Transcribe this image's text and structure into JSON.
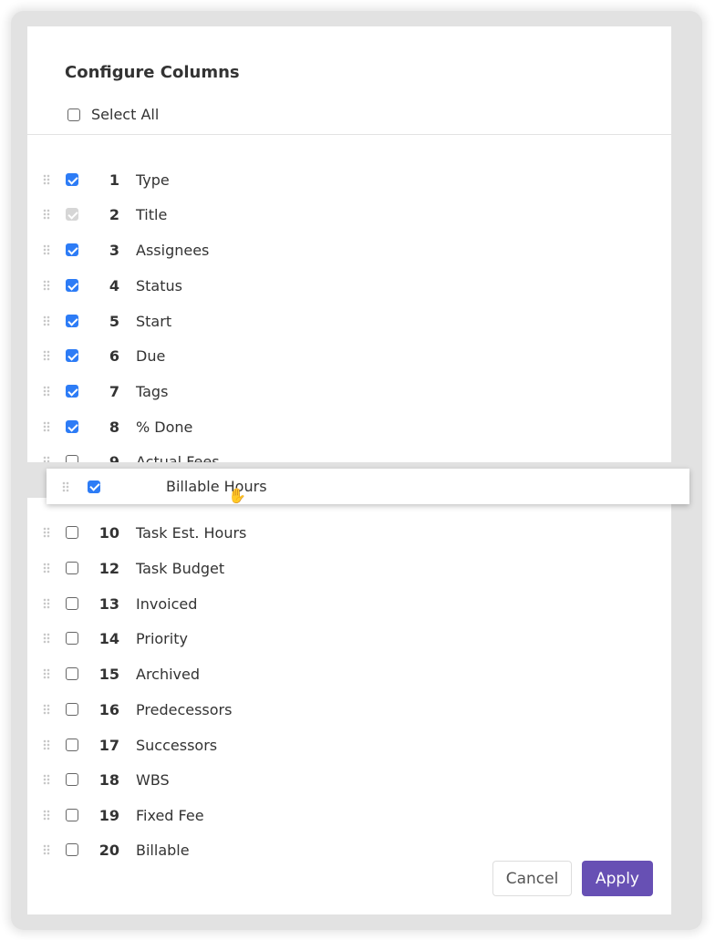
{
  "dialog": {
    "title": "Configure Columns",
    "select_all_label": "Select All",
    "select_all_checked": false,
    "cancel_label": "Cancel",
    "apply_label": "Apply",
    "accent_color": "#6750b4",
    "checkbox_color": "#2d7cf6"
  },
  "columns_top": [
    {
      "num": "1",
      "label": "Type",
      "state": "checked"
    },
    {
      "num": "2",
      "label": "Title",
      "state": "disabled-checked"
    },
    {
      "num": "3",
      "label": "Assignees",
      "state": "checked"
    },
    {
      "num": "4",
      "label": "Status",
      "state": "checked"
    },
    {
      "num": "5",
      "label": "Start",
      "state": "checked"
    },
    {
      "num": "6",
      "label": "Due",
      "state": "checked"
    },
    {
      "num": "7",
      "label": "Tags",
      "state": "checked"
    },
    {
      "num": "8",
      "label": "% Done",
      "state": "checked"
    },
    {
      "num": "9",
      "label": "Actual Fees",
      "state": "unchecked"
    }
  ],
  "dragging": {
    "label": "Billable Hours",
    "state": "checked",
    "cursor_icon": "grabbing-hand-icon"
  },
  "columns_bottom": [
    {
      "num": "10",
      "label": "Task Est. Hours",
      "state": "unchecked"
    },
    {
      "num": "12",
      "label": "Task Budget",
      "state": "unchecked"
    },
    {
      "num": "13",
      "label": "Invoiced",
      "state": "unchecked"
    },
    {
      "num": "14",
      "label": "Priority",
      "state": "unchecked"
    },
    {
      "num": "15",
      "label": "Archived",
      "state": "unchecked"
    },
    {
      "num": "16",
      "label": "Predecessors",
      "state": "unchecked"
    },
    {
      "num": "17",
      "label": "Successors",
      "state": "unchecked"
    },
    {
      "num": "18",
      "label": "WBS",
      "state": "unchecked"
    },
    {
      "num": "19",
      "label": "Fixed Fee",
      "state": "unchecked"
    },
    {
      "num": "20",
      "label": "Billable",
      "state": "unchecked"
    }
  ]
}
